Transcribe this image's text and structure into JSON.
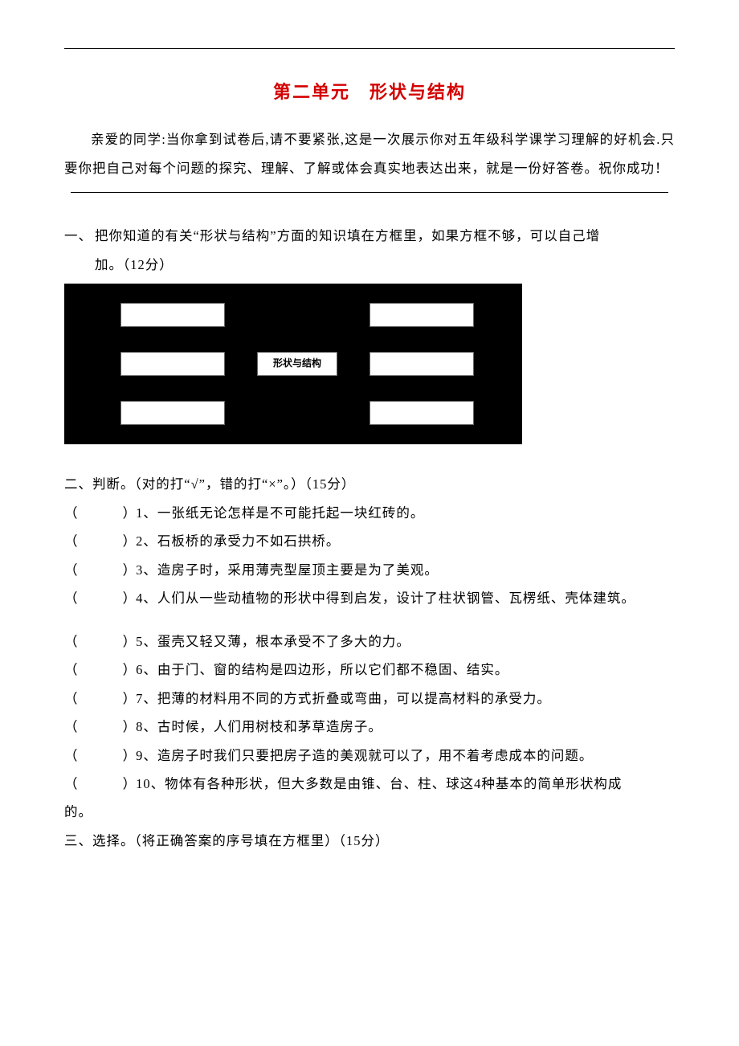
{
  "title": "第二单元　形状与结构",
  "intro": "亲爱的同学:当你拿到试卷后,请不要紧张,这是一次展示你对五年级科学课学习理解的好机会.只要你把自己对每个问题的探究、理解、了解或体会真实地表达出来，就是一份好答卷。祝你成功！",
  "q1": {
    "num": "一、",
    "line1_rest": "把你知道的有关“形状与结构”方面的知识填在方框里，如果方框不够，可以自己增",
    "line2": "加。（12分）"
  },
  "diagram_center_label": "形状与结构",
  "section2_heading": "二、判断。（对的打“√”，错的打“×”。）（15分）",
  "judges": [
    "1、一张纸无论怎样是不可能托起一块红砖的。",
    "2、石板桥的承受力不如石拱桥。",
    "3、造房子时，采用薄壳型屋顶主要是为了美观。",
    "4、人们从一些动植物的形状中得到启发，设计了柱状钢管、瓦楞纸、壳体建筑。",
    "5、蛋壳又轻又薄，根本承受不了多大的力。",
    "6、由于门、窗的结构是四边形，所以它们都不稳固、结实。",
    "7、把薄的材料用不同的方式折叠或弯曲，可以提高材料的承受力。",
    "8、古时候，人们用树枝和茅草造房子。",
    "9、造房子时我们只要把房子造的美观就可以了，用不着考虑成本的问题。",
    "10、物体有各种形状，但大多数是由锥、台、柱、球这4种基本的简单形状构成"
  ],
  "judges_tail": "的。",
  "section3_heading": "三、选择。（将正确答案的序号填在方框里）（15分）"
}
